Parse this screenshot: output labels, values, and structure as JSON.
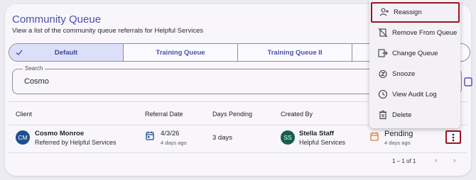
{
  "header": {
    "title": "Community Queue",
    "subtitle": "View a list of the community queue referrals for Helpful Services"
  },
  "tabs": [
    {
      "label": "Default",
      "active": true
    },
    {
      "label": "Training Queue",
      "active": false
    },
    {
      "label": "Training Queue II",
      "active": false
    },
    {
      "label": "",
      "active": false
    }
  ],
  "search": {
    "label": "Search",
    "value": "Cosmo"
  },
  "table": {
    "columns": [
      "Client",
      "Referral Date",
      "Days Pending",
      "Created By"
    ],
    "rows": [
      {
        "client_initials": "CM",
        "client_name": "Cosmo Monroe",
        "client_sub": "Referred by Helpful Services",
        "referral_date": "4/3/26",
        "referral_ago": "4 days ago",
        "days_pending": "3 days",
        "creator_initials": "SS",
        "creator_name": "Stella Staff",
        "creator_org": "Helpful Services",
        "status": "Pending",
        "status_ago": "4 days ago"
      }
    ],
    "pagination": "1 – 1 of 1"
  },
  "menu": {
    "items": [
      {
        "label": "Reassign",
        "icon": "person-add-icon"
      },
      {
        "label": "Remove From Queue",
        "icon": "remove-queue-icon"
      },
      {
        "label": "Change Queue",
        "icon": "change-queue-icon"
      },
      {
        "label": "Snooze",
        "icon": "snooze-icon"
      },
      {
        "label": "View Audit Log",
        "icon": "audit-log-icon"
      },
      {
        "label": "Delete",
        "icon": "delete-icon"
      }
    ]
  },
  "colors": {
    "accent": "#4a4fb0",
    "highlight": "#9b1521",
    "avatar_client": "#1d4f91",
    "avatar_staff": "#14604f",
    "pending": "#e37a2d"
  }
}
